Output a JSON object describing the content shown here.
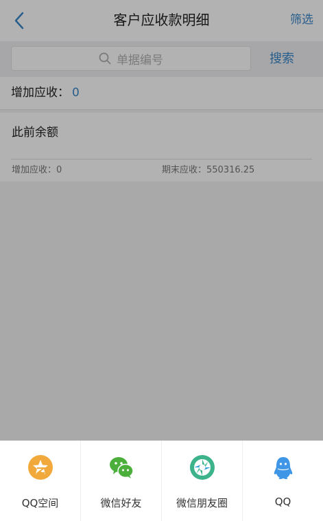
{
  "nav": {
    "title": "客户应收款明细",
    "filter_label": "筛选",
    "back_icon": "chevron-left-icon"
  },
  "search": {
    "placeholder": "单据编号",
    "button_label": "搜索"
  },
  "summary": {
    "label": "增加应收：",
    "value": "0"
  },
  "record": {
    "title": "此前余额",
    "left_label": "增加应收：",
    "left_value": "0",
    "right_label": "期末应收：",
    "right_value": "550316.25"
  },
  "share": {
    "items": [
      {
        "label": "QQ空间",
        "icon": "qzone-icon",
        "color": "#f2a93b"
      },
      {
        "label": "微信好友",
        "icon": "wechat-icon",
        "color": "#4caf3c"
      },
      {
        "label": "微信朋友圈",
        "icon": "moments-icon",
        "color": "#3cb38a"
      },
      {
        "label": "QQ",
        "icon": "qq-icon",
        "color": "#3f96e6"
      }
    ]
  },
  "colors": {
    "accent": "#3a87c8"
  }
}
